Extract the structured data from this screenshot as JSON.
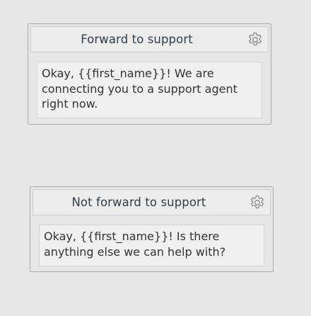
{
  "nodes": [
    {
      "title": "Forward to support",
      "message": "Okay, {{first_name}}! We are connecting you to a support agent right now.",
      "icon": "gear-icon"
    },
    {
      "title": "Not forward to support",
      "message": "Okay, {{first_name}}! Is there anything else we can help with?",
      "icon": "gear-icon"
    }
  ],
  "colors": {
    "background": "#e7e7e7",
    "card_border": "#a9a9a9",
    "title_text": "#2f3d4a",
    "message_text": "#333333",
    "icon": "#8a8a8a"
  }
}
